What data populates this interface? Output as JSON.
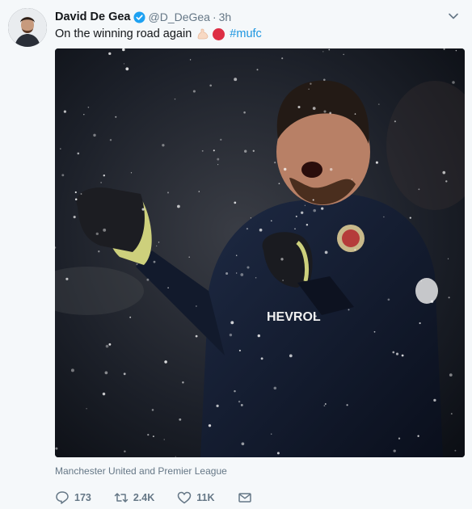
{
  "tweet": {
    "author_name": "David De Gea",
    "handle": "@D_DeGea",
    "separator": "·",
    "time": "3h",
    "text": "On the winning road again",
    "hashtag": "#mufc",
    "media_tags": "Manchester United and Premier League",
    "media_text": {
      "sponsor": "HEVROL"
    },
    "actions": {
      "replies": "173",
      "retweets": "2.4K",
      "likes": "11K"
    }
  },
  "icons": {
    "verified": "verified-badge-icon",
    "menu": "chevron-down-icon",
    "reply": "reply-icon",
    "retweet": "retweet-icon",
    "like": "heart-icon",
    "message": "envelope-icon"
  },
  "colors": {
    "background": "#f5f8fa",
    "link": "#1b95e0",
    "muted": "#657786",
    "verified": "#1da1f2"
  }
}
